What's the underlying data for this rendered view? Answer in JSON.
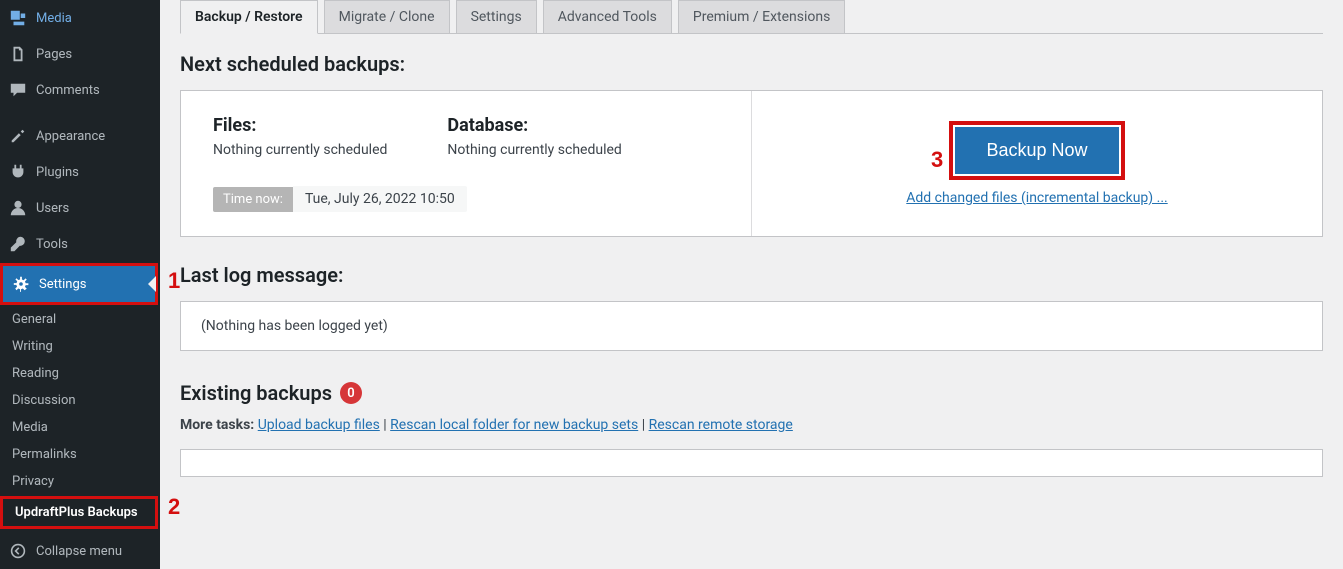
{
  "sidebar": {
    "media": "Media",
    "pages": "Pages",
    "comments": "Comments",
    "appearance": "Appearance",
    "plugins": "Plugins",
    "users": "Users",
    "tools": "Tools",
    "settings": "Settings",
    "sub": {
      "general": "General",
      "writing": "Writing",
      "reading": "Reading",
      "discussion": "Discussion",
      "media": "Media",
      "permalinks": "Permalinks",
      "privacy": "Privacy",
      "updraft": "UpdraftPlus Backups"
    },
    "collapse": "Collapse menu"
  },
  "tabs": {
    "backup_restore": "Backup / Restore",
    "migrate_clone": "Migrate / Clone",
    "settings": "Settings",
    "advanced": "Advanced Tools",
    "premium": "Premium / Extensions"
  },
  "next_backups": {
    "heading": "Next scheduled backups:",
    "files_label": "Files:",
    "files_value": "Nothing currently scheduled",
    "db_label": "Database:",
    "db_value": "Nothing currently scheduled",
    "time_now_label": "Time now:",
    "time_now_value": "Tue, July 26, 2022 10:50",
    "backup_now": "Backup Now",
    "incremental_link": "Add changed files (incremental backup) ..."
  },
  "log": {
    "heading": "Last log message:",
    "content": "(Nothing has been logged yet)"
  },
  "existing": {
    "heading": "Existing backups",
    "count": "0",
    "more_tasks_label": "More tasks:",
    "upload": "Upload backup files",
    "rescan_local": "Rescan local folder for new backup sets",
    "rescan_remote": "Rescan remote storage"
  },
  "annotations": {
    "a1": "1",
    "a2": "2",
    "a3": "3"
  }
}
